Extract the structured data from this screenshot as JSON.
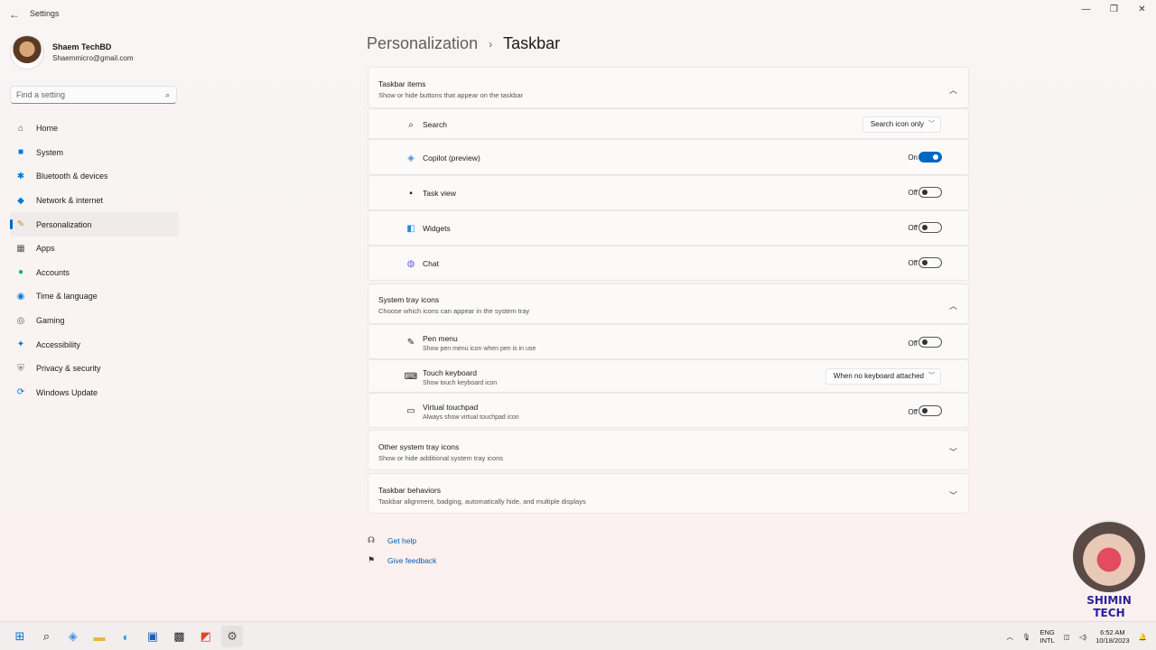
{
  "titlebar": {
    "app_title": "Settings",
    "minimize": "—",
    "restore": "❐",
    "close": "✕"
  },
  "profile": {
    "name": "Shaem TechBD",
    "email": "Shaemmicro@gmail.com"
  },
  "search": {
    "placeholder": "Find a setting"
  },
  "nav": [
    {
      "label": "Home",
      "icon": "home-icon",
      "glyph": "⌂",
      "color": "#444444"
    },
    {
      "label": "System",
      "icon": "monitor-icon",
      "glyph": "■",
      "color": "#0078d4"
    },
    {
      "label": "Bluetooth & devices",
      "icon": "bluetooth-icon",
      "glyph": "✱",
      "color": "#0078d4"
    },
    {
      "label": "Network & internet",
      "icon": "wifi-icon",
      "glyph": "◆",
      "color": "#0078d4"
    },
    {
      "label": "Personalization",
      "icon": "brush-icon",
      "glyph": "✎",
      "color": "#d08a2e"
    },
    {
      "label": "Apps",
      "icon": "apps-icon",
      "glyph": "▦",
      "color": "#5a5a5a"
    },
    {
      "label": "Accounts",
      "icon": "account-icon",
      "glyph": "●",
      "color": "#1fa87a"
    },
    {
      "label": "Time & language",
      "icon": "globe-icon",
      "glyph": "◉",
      "color": "#0078d4"
    },
    {
      "label": "Gaming",
      "icon": "gamepad-icon",
      "glyph": "◎",
      "color": "#5a5a5a"
    },
    {
      "label": "Accessibility",
      "icon": "accessibility-icon",
      "glyph": "✦",
      "color": "#0078d4"
    },
    {
      "label": "Privacy & security",
      "icon": "shield-icon",
      "glyph": "⛨",
      "color": "#6b6b6b"
    },
    {
      "label": "Windows Update",
      "icon": "update-icon",
      "glyph": "⟳",
      "color": "#0078d4"
    }
  ],
  "breadcrumb": {
    "parent": "Personalization",
    "separator": "›",
    "current": "Taskbar"
  },
  "taskbar_items": {
    "title": "Taskbar items",
    "subtitle": "Show or hide buttons that appear on the taskbar",
    "search": {
      "label": "Search",
      "value": "Search icon only"
    },
    "copilot": {
      "label": "Copilot (preview)",
      "state": "On"
    },
    "task_view": {
      "label": "Task view",
      "state": "Off"
    },
    "widgets": {
      "label": "Widgets",
      "state": "Off"
    },
    "chat": {
      "label": "Chat",
      "state": "Off"
    }
  },
  "tray_icons": {
    "title": "System tray icons",
    "subtitle": "Choose which icons can appear in the system tray",
    "pen_menu": {
      "label": "Pen menu",
      "sub": "Show pen menu icon when pen is in use",
      "state": "Off"
    },
    "touch_keyboard": {
      "label": "Touch keyboard",
      "sub": "Show touch keyboard icon",
      "value": "When no keyboard attached"
    },
    "virtual_touchpad": {
      "label": "Virtual touchpad",
      "sub": "Always show virtual touchpad icon",
      "state": "Off"
    }
  },
  "other_tray": {
    "title": "Other system tray icons",
    "subtitle": "Show or hide additional system tray icons"
  },
  "behaviors": {
    "title": "Taskbar behaviors",
    "subtitle": "Taskbar alignment, badging, automatically hide, and multiple displays"
  },
  "links": {
    "help": "Get help",
    "feedback": "Give feedback"
  },
  "watermark": {
    "text": "SHIMIN TECH"
  },
  "tray": {
    "lang_top": "ENG",
    "lang_bottom": "INTL",
    "time": "6:52 AM",
    "date": "10/18/2023"
  },
  "colors": {
    "accent": "#0067c0",
    "link": "#005fb8"
  }
}
